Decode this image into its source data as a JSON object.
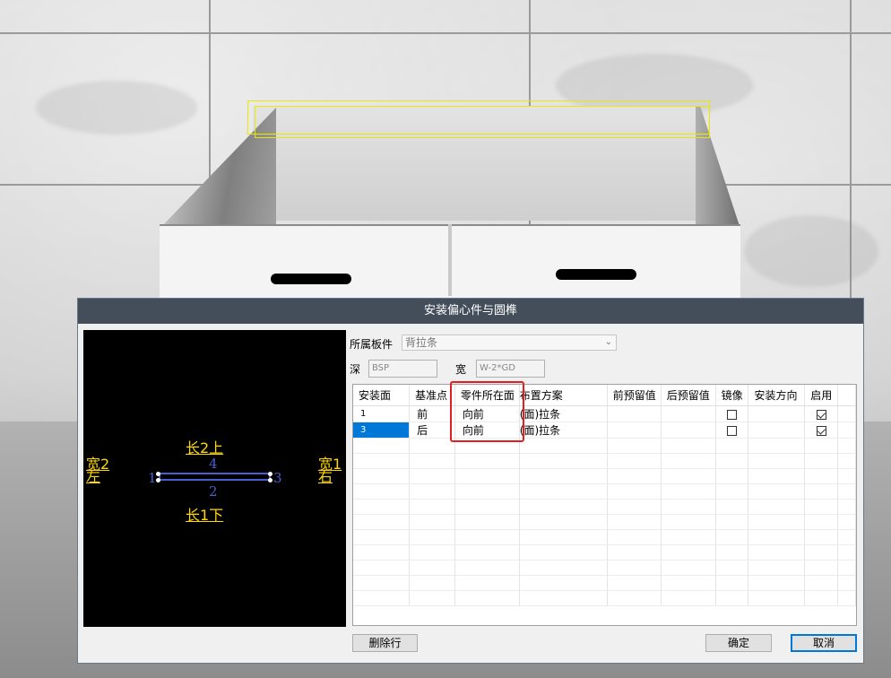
{
  "dialog": {
    "title": "安装偏心件与圆榫",
    "part_label": "所属板件",
    "part_value": "背拉条",
    "depth_label": "深",
    "depth_value": "BSP",
    "width_label": "宽",
    "width_value": "W-2*GD"
  },
  "preview": {
    "top_label": "长2上",
    "bottom_label": "长1下",
    "left_label_1": "宽2",
    "left_label_2": "左",
    "right_label_1": "宽1",
    "right_label_2": "右",
    "num_top": "4",
    "num_bottom": "2",
    "num_left": "1",
    "num_right": "3"
  },
  "table": {
    "columns": [
      "安装面",
      "基准点",
      "零件所在面",
      "布置方案",
      "前预留值",
      "后预留值",
      "镜像",
      "安装方向",
      "启用"
    ],
    "rows": [
      {
        "face": "1",
        "base": "前",
        "side": "向前",
        "plan": "(面)拉条",
        "front": "",
        "back": "",
        "mirror": false,
        "direction": "",
        "enabled": true
      },
      {
        "face": "3",
        "base": "后",
        "side": "向前",
        "plan": "(面)拉条",
        "front": "",
        "back": "",
        "mirror": false,
        "direction": "",
        "enabled": true
      }
    ]
  },
  "buttons": {
    "delete_row": "删除行",
    "ok": "确定",
    "cancel": "取消"
  },
  "colors": {
    "title_bar": "#434e5a",
    "selection": "#0078d7",
    "highlight": "#e02020",
    "preview_text": "#ffd800",
    "preview_line": "#4a5fd0"
  }
}
